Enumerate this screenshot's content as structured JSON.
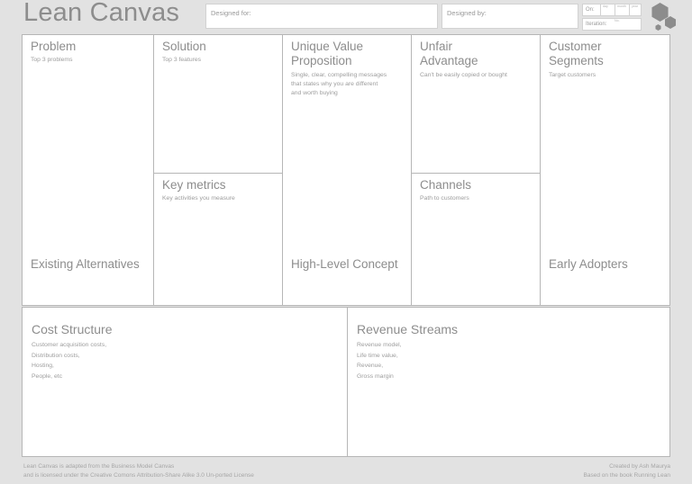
{
  "header": {
    "brand_title": "Lean Canvas",
    "designed_for_label": "Designed for:",
    "designed_for_value": "",
    "designed_by_label": "Designed by:",
    "designed_by_value": "",
    "on_label": "On:",
    "day_label": "day",
    "month_label": "month",
    "year_label": "year",
    "iteration_label": "Iteration:",
    "iteration_no_label": "No.",
    "logo_color": "#8c8c8c"
  },
  "canvas": {
    "problem": {
      "title": "Problem",
      "subtitle": "Top 3 problems",
      "bottom_label": "Existing Alternatives"
    },
    "solution": {
      "title": "Solution",
      "subtitle": "Top 3 features"
    },
    "key_metrics": {
      "title": "Key metrics",
      "subtitle": "Key activities you measure"
    },
    "uvp": {
      "title": "Unique Value\nProposition",
      "subtitle": "Single, clear, compelling messages\nthat states why you are different\nand worth buying",
      "bottom_label": "High-Level Concept"
    },
    "unfair_advantage": {
      "title": "Unfair\nAdvantage",
      "subtitle": "Can't be easily copied or bought"
    },
    "channels": {
      "title": "Channels",
      "subtitle": "Path to customers"
    },
    "customer_segments": {
      "title": "Customer\nSegments",
      "subtitle": "Target customers",
      "bottom_label": "Early Adopters"
    },
    "cost_structure": {
      "title": "Cost Structure",
      "items": "Customer acquisition costs,\nDistribution costs,\nHosting,\nPeople, etc"
    },
    "revenue_streams": {
      "title": "Revenue Streams",
      "items": "Revenue model,\nLife time value,\nRevenue,\nGross margin"
    }
  },
  "footer": {
    "left": "Lean Canvas is adapted from the Business Model Canvas\nand is licensed under the Creative Comons Attribution-Share Alike 3.0 Un-ported License",
    "right": "Created by Ash Maurya\nBased on the book Running Lean"
  }
}
